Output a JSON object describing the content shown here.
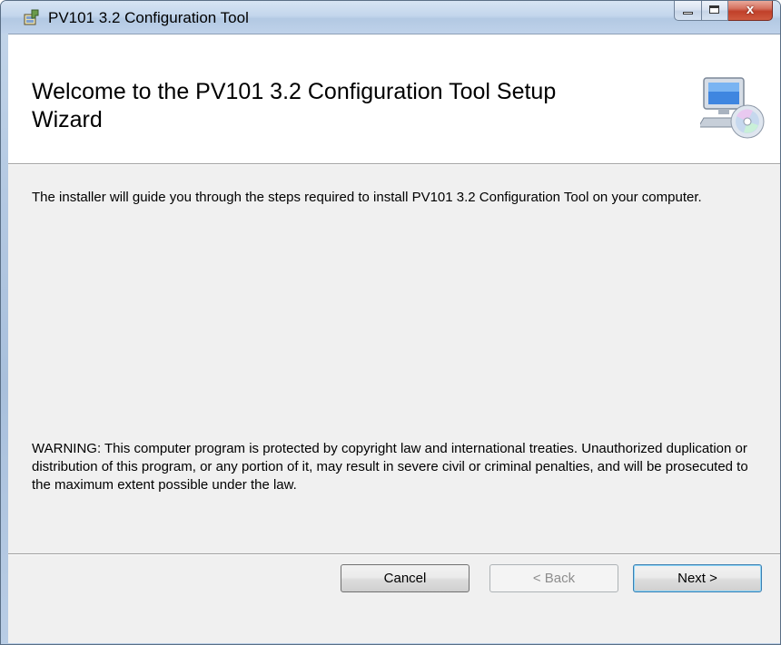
{
  "window": {
    "title": "PV101 3.2 Configuration Tool",
    "close_glyph": "x"
  },
  "banner": {
    "title": "Welcome to the PV101 3.2 Configuration Tool Setup Wizard",
    "icon": "computer-cd-icon"
  },
  "body": {
    "description": "The installer will guide you through the steps required to install PV101 3.2 Configuration Tool on your computer.",
    "warning": "WARNING: This computer program is protected by copyright law and international treaties. Unauthorized duplication or distribution of this program, or any portion of it, may result in severe civil or criminal penalties, and will be prosecuted to the maximum extent possible under the law."
  },
  "buttons": {
    "cancel": "Cancel",
    "back": "< Back",
    "next": "Next >"
  },
  "colors": {
    "title_bar": "#c3d6ec",
    "close_button": "#c0402a",
    "dialog_background": "#f0f0f0",
    "disabled_text": "#8d8d8d"
  }
}
